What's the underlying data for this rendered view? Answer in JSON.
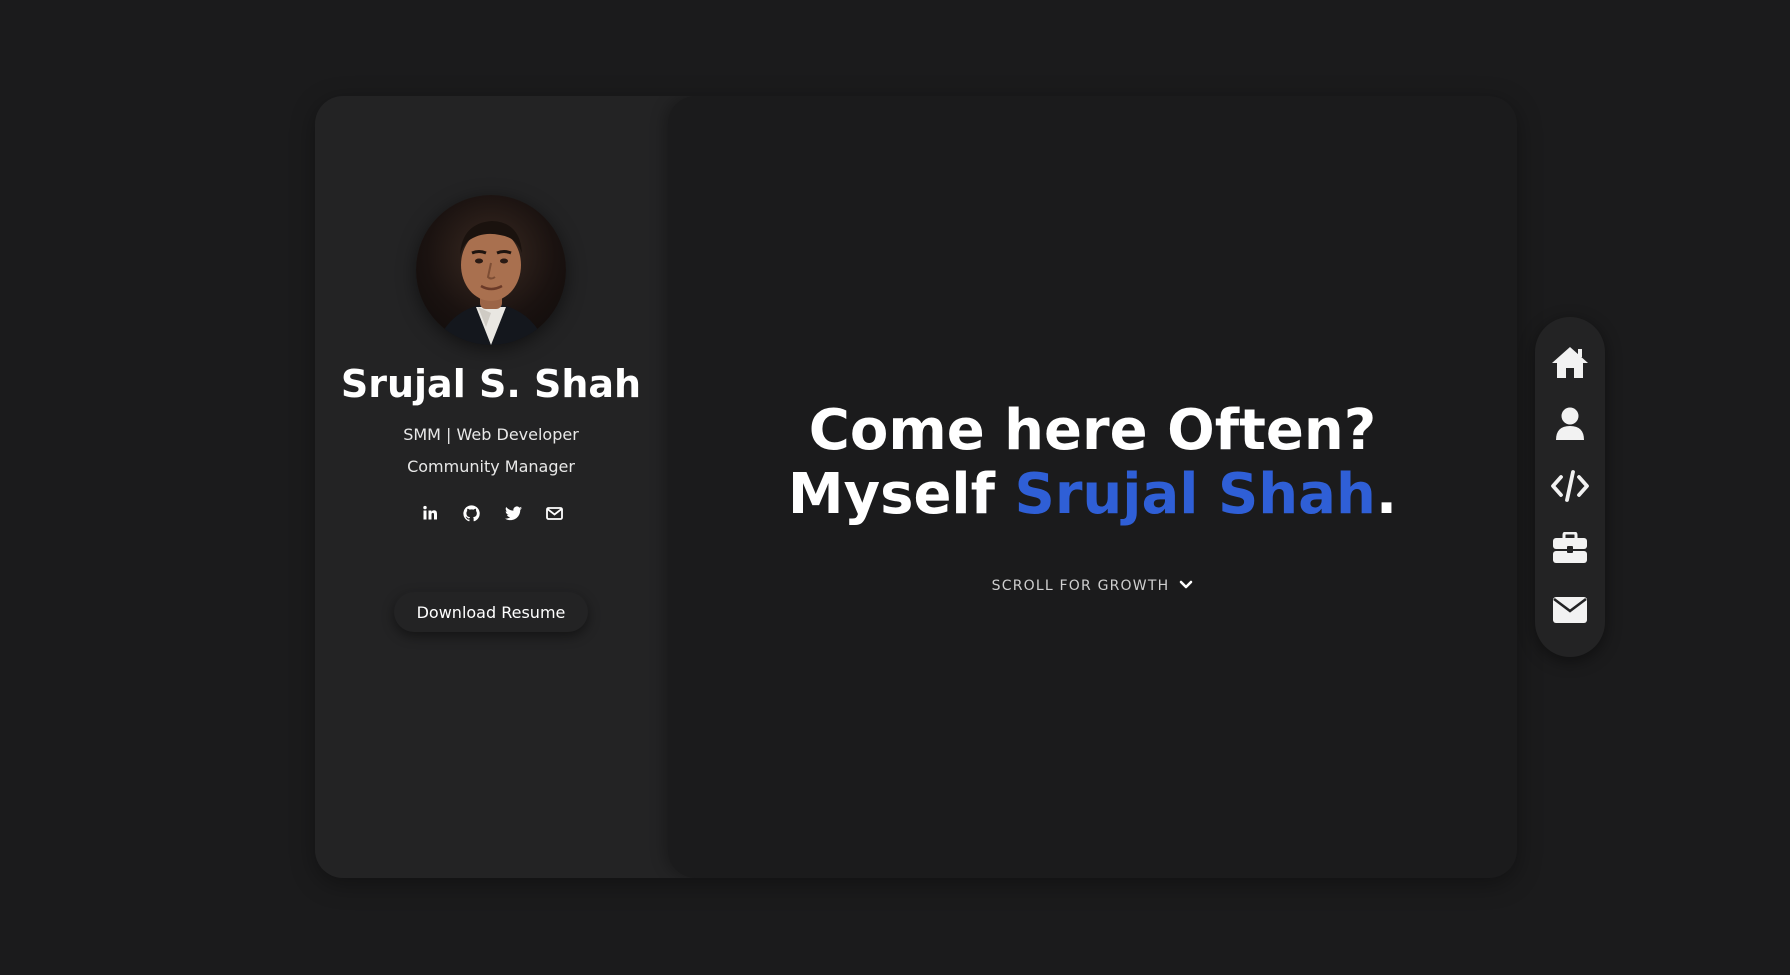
{
  "profile": {
    "name": "Srujal S. Shah",
    "role_line_1": "SMM | Web Developer",
    "role_line_2": "Community Manager",
    "avatar_icon": "profile-photo",
    "socials": [
      {
        "icon": "linkedin-icon"
      },
      {
        "icon": "github-icon"
      },
      {
        "icon": "twitter-icon"
      },
      {
        "icon": "mail-icon"
      }
    ],
    "resume_label": "Download Resume"
  },
  "hero": {
    "line1": "Come here Often?",
    "line2_prefix": "Myself ",
    "line2_highlight": "Srujal Shah",
    "line2_suffix": ".",
    "scroll_label": "SCROLL FOR GROWTH"
  },
  "nav": {
    "items": [
      {
        "icon": "home-icon"
      },
      {
        "icon": "user-icon"
      },
      {
        "icon": "code-icon"
      },
      {
        "icon": "briefcase-icon"
      },
      {
        "icon": "envelope-icon"
      }
    ]
  },
  "colors": {
    "background": "#1b1b1c",
    "panel": "#232324",
    "accent": "#2f5fd6",
    "text": "#ffffff"
  }
}
